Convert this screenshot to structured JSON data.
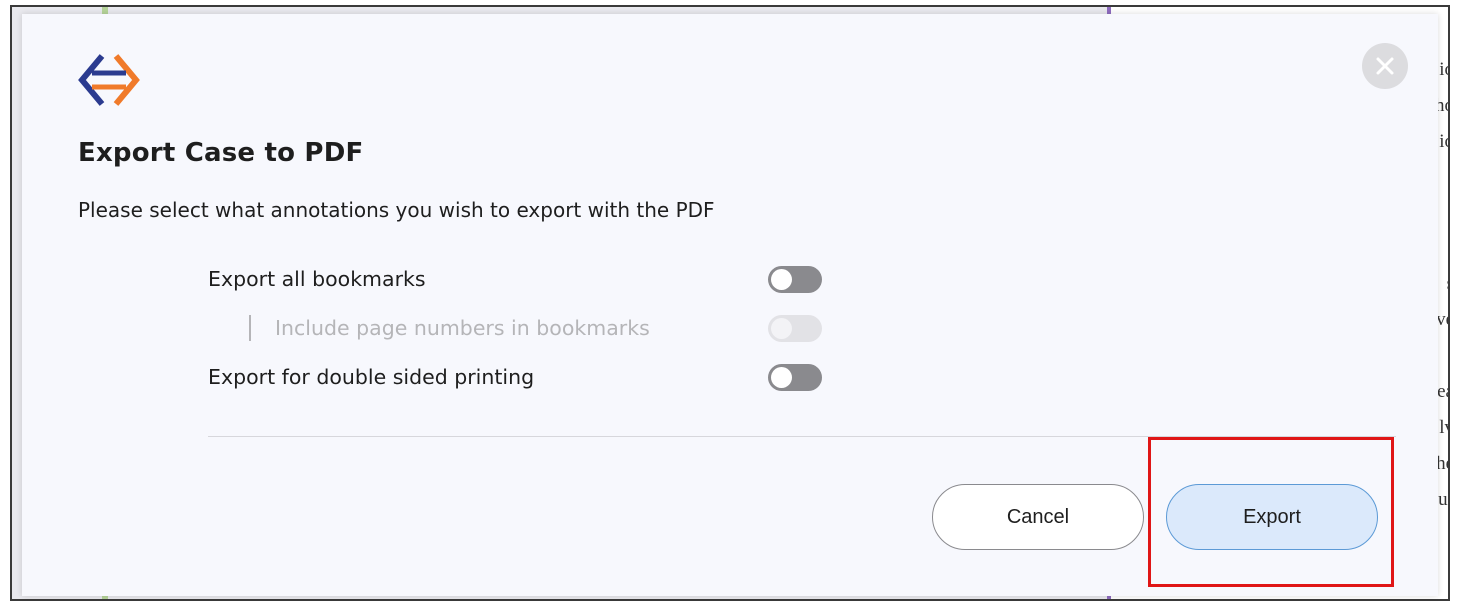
{
  "dialog": {
    "title": "Export Case to PDF",
    "subtitle": "Please select what annotations you wish to export with the PDF",
    "options": [
      {
        "label": "Export all bookmarks",
        "enabled": false,
        "disabled": false
      },
      {
        "label": "Include page numbers in bookmarks",
        "enabled": false,
        "disabled": true
      },
      {
        "label": "Export for double sided printing",
        "enabled": false,
        "disabled": false
      }
    ],
    "cancel_label": "Cancel",
    "export_label": "Export"
  },
  "background": {
    "fragments": [
      "io",
      "ho",
      "io",
      "t",
      "s",
      "ve",
      "i",
      "ea",
      "lv",
      "he",
      "ur"
    ]
  },
  "colors": {
    "dialog_bg": "#f7f8fd",
    "logo_blue": "#2b3b8f",
    "logo_orange": "#f07a2a",
    "toggle_off": "#8a8a8e",
    "export_button_bg": "#dbe9fb",
    "export_button_border": "#5c9ad6",
    "highlight_red": "#e01616"
  },
  "icons": {
    "logo": "app-logo-icon",
    "close": "close-icon"
  }
}
